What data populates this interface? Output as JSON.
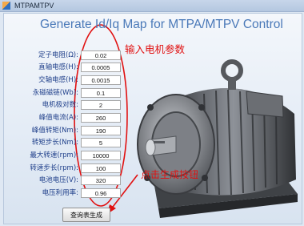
{
  "window": {
    "title": "MTPAMTPV"
  },
  "heading": "Generate Id/Iq Map for MTPA/MTPV Control",
  "annotations": {
    "input_params": "输入电机参数",
    "click_generate": "点击生成按钮"
  },
  "params": [
    {
      "label": "定子电阻(Ω):",
      "value": "0.02"
    },
    {
      "label": "直轴电感(H):",
      "value": "0.0005"
    },
    {
      "label": "交轴电感(H):",
      "value": "0.0015"
    },
    {
      "label": "永磁磁链(Wb):",
      "value": "0.1"
    },
    {
      "label": "电机极对数:",
      "value": "2"
    },
    {
      "label": "峰值电流(A):",
      "value": "260"
    },
    {
      "label": "峰值转矩(Nm):",
      "value": "190"
    },
    {
      "label": "转矩步长(Nm):",
      "value": "5"
    },
    {
      "label": "最大转速(rpm):",
      "value": "10000"
    },
    {
      "label": "转速步长(rpm):",
      "value": "100"
    },
    {
      "label": "电池电压(V):",
      "value": "320"
    },
    {
      "label": "电压利用率:",
      "value": "0.96"
    }
  ],
  "generate_button": {
    "label": "查询表生成"
  },
  "colors": {
    "heading": "#4a79b8",
    "label": "#1f3f8a",
    "annotation": "#e11010"
  },
  "icons": {
    "app": "matlab-icon",
    "arrow": "red-arrow-icon",
    "motor": "motor-image"
  }
}
